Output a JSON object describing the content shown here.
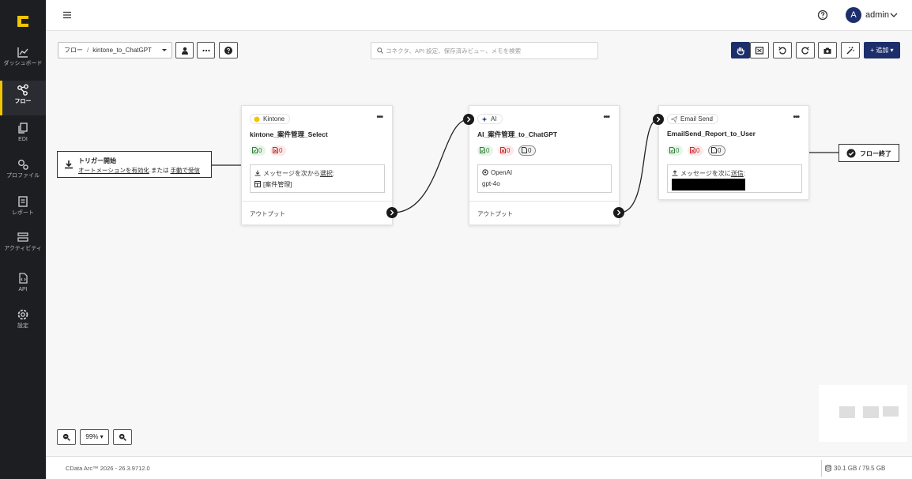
{
  "nav": {
    "items": [
      {
        "label": "ダッシュボード",
        "icon": "chart-line-icon"
      },
      {
        "label": "フロー",
        "icon": "share-nodes-icon",
        "active": true
      },
      {
        "label": "EDI",
        "icon": "documents-icon"
      },
      {
        "label": "プロファイル",
        "icon": "gears-icon"
      },
      {
        "label": "レポート",
        "icon": "report-icon"
      },
      {
        "label": "アクティビティ",
        "icon": "layers-icon"
      },
      {
        "label": "API",
        "icon": "api-file-icon"
      },
      {
        "label": "設定",
        "icon": "settings-icon"
      }
    ]
  },
  "header": {
    "user": "admin",
    "avatar_initial": "A"
  },
  "toolbar": {
    "breadcrumb_root": "フロー",
    "breadcrumb_sep": "/",
    "flow_name": "kintone_to_ChatGPT",
    "search_placeholder": "コネクタ、API 設定、保存済みビュー、メモを検索",
    "add_label": "+ 追加 ▾"
  },
  "trigger": {
    "title": "トリガー開始",
    "link1": "オートメーションを有効化",
    "middle": "または",
    "link2": "手動で受信"
  },
  "nodes": [
    {
      "tag": "Kintone",
      "title": "kintone_案件管理_Select",
      "success": "0",
      "error": "0",
      "config_line1_prefix": "メッセージを次から",
      "config_line1_link": "選択",
      "config_line1_suffix": ":",
      "config_line2": "[案件管理]",
      "output": "アウトプット"
    },
    {
      "tag": "AI",
      "title": "AI_案件管理_to_ChatGPT",
      "success": "0",
      "error": "0",
      "pending": "0",
      "config_line1": "OpenAI",
      "config_line2": "gpt-4o",
      "output": "アウトプット"
    },
    {
      "tag": "Email Send",
      "title": "EmailSend_Report_to_User",
      "success": "0",
      "error": "0",
      "pending": "0",
      "config_line1_prefix": "メッセージを次に",
      "config_line1_link": "送信",
      "config_line1_suffix": ":"
    }
  ],
  "end_node": {
    "label": "フロー終了"
  },
  "zoom": {
    "value": "99% ▾"
  },
  "footer": {
    "version": "CData Arc™ 2026 - 26.3.9712.0",
    "disk": "30.1 GB / 79.5 GB"
  },
  "colors": {
    "nav_bg": "#1c1e22",
    "accent_yellow": "#f2c500",
    "primary_navy": "#1c2f6b"
  }
}
